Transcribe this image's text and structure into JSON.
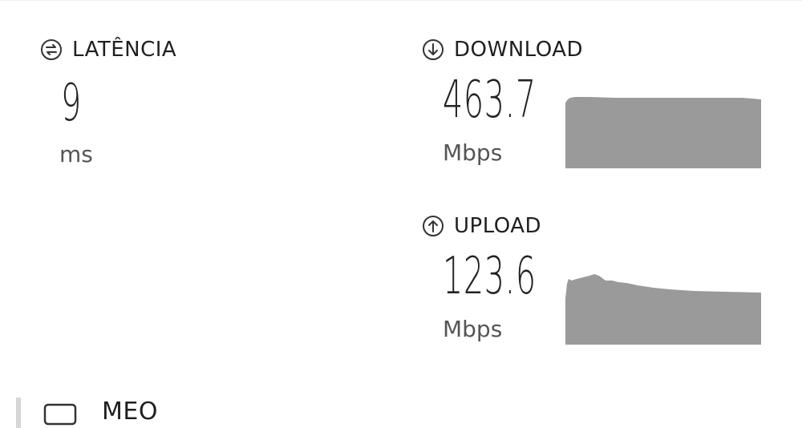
{
  "latency": {
    "label": "LATÊNCIA",
    "value": "9",
    "unit": "ms",
    "icon": "ping-icon"
  },
  "download": {
    "label": "DOWNLOAD",
    "value": "463.7",
    "unit": "Mbps",
    "icon": "arrow-down-circle-icon"
  },
  "upload": {
    "label": "UPLOAD",
    "value": "123.6",
    "unit": "Mbps",
    "icon": "arrow-up-circle-icon"
  },
  "server": {
    "name": "MEO",
    "icon": "server-icon"
  },
  "colors": {
    "graph_fill": "#9a9a9a",
    "text": "#222222",
    "muted": "#555555"
  }
}
